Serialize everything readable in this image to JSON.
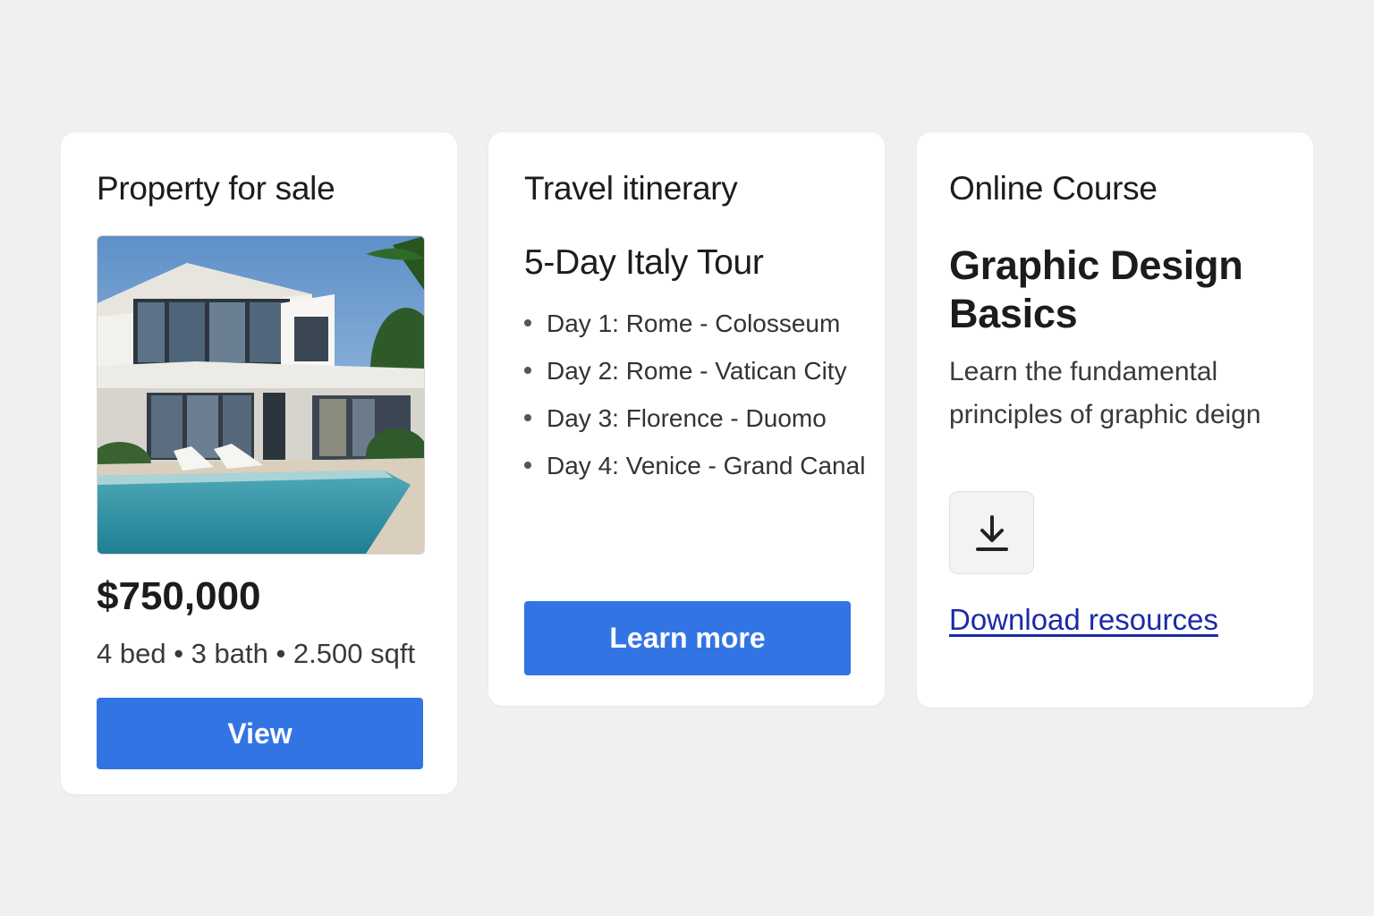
{
  "colors": {
    "page_background": "#f0f0f0",
    "card_background": "#ffffff",
    "primary_button": "#3374e5",
    "link": "#1a2aa8"
  },
  "property_card": {
    "title": "Property for sale",
    "image_icon": "house-pool-photo",
    "price": "$750,000",
    "specs": "4 bed • 3 bath • 2.500 sqft",
    "button_label": "View"
  },
  "travel_card": {
    "title": "Travel itinerary",
    "tour_name": "5-Day Italy Tour",
    "days": [
      "Day 1: Rome - Colosseum",
      "Day 2: Rome - Vatican City",
      "Day 3: Florence - Duomo",
      "Day 4: Venice - Grand Canal"
    ],
    "button_label": "Learn more"
  },
  "course_card": {
    "title": "Online Course",
    "course_name": "Graphic Design Basics",
    "description": "Learn the fundamental principles of graphic deign",
    "download_icon": "download-icon",
    "link_label": "Download resources"
  }
}
